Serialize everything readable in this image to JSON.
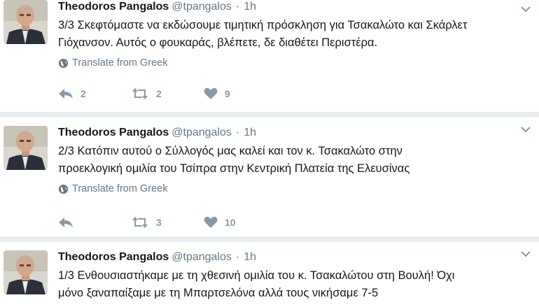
{
  "tweets": [
    {
      "name": "Theodoros Pangalos",
      "handle": "@tpangalos",
      "dot": "·",
      "time": "1h",
      "lines": [
        "3/3 Σκεφτόμαστε να εκδώσουμε τιμητική πρόσκληση για Τσακαλώτο και Σκάρλετ",
        "Γιόχανσον. Αυτός ο φουκαράς, βλέπετε, δε διαθέτει Περιστέρα."
      ],
      "translate": "Translate from Greek",
      "replies": "2",
      "retweets": "2",
      "likes": "9"
    },
    {
      "name": "Theodoros Pangalos",
      "handle": "@tpangalos",
      "dot": "·",
      "time": "1h",
      "lines": [
        "2/3 Κατόπιν αυτού ο Σύλλογός μας καλεί και τον κ. Τσακαλώτο στην",
        "προεκλογική ομιλία του Τσίπρα στην Κεντρική Πλατεία της Ελευσίνας"
      ],
      "translate": "Translate from Greek",
      "replies": "",
      "retweets": "3",
      "likes": "10"
    },
    {
      "name": "Theodoros Pangalos",
      "handle": "@tpangalos",
      "dot": "·",
      "time": "1h",
      "lines": [
        "1/3 Ενθουσιαστήκαμε με τη χθεσινή ομιλία του κ. Τσακαλώτου στη Βουλή! Όχι",
        "μόνο ξαναπαίξαμε με τη Μπαρτσελόνα αλλά τους νικήσαμε 7-5"
      ]
    }
  ],
  "icons": {
    "reply": "reply-icon",
    "retweet": "retweet-icon",
    "like": "heart-icon",
    "translate": "globe-icon",
    "menu": "chevron-down-icon"
  },
  "colors": {
    "icon_gray": "#8899a6",
    "meta_gray": "#657786",
    "separator": "#e6ecf0"
  }
}
